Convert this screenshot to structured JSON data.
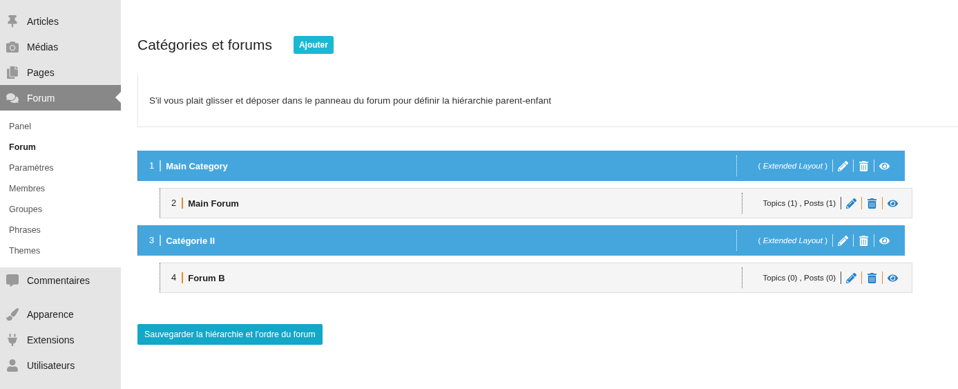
{
  "sidebar": {
    "items": [
      {
        "label": "Articles",
        "selected": false
      },
      {
        "label": "Médias",
        "selected": false
      },
      {
        "label": "Pages",
        "selected": false
      },
      {
        "label": "Forum",
        "selected": true,
        "children": [
          {
            "label": "Panel",
            "selected": false
          },
          {
            "label": "Forum",
            "selected": true
          },
          {
            "label": "Paramètres",
            "selected": false
          },
          {
            "label": "Membres",
            "selected": false
          },
          {
            "label": "Groupes",
            "selected": false
          },
          {
            "label": "Phrases",
            "selected": false
          },
          {
            "label": "Themes",
            "selected": false
          }
        ]
      },
      {
        "label": "Commentaires",
        "selected": false
      },
      {
        "label": "Apparence",
        "selected": false
      },
      {
        "label": "Extensions",
        "selected": false
      },
      {
        "label": "Utilisateurs",
        "selected": false
      }
    ]
  },
  "page": {
    "title": "Catégories et forums",
    "add_button": "Ajouter",
    "notice": "S'il vous plait glisser et déposer dans le panneau du forum pour définir la hiérarchie parent-enfant",
    "rows": [
      {
        "kind": "category",
        "number": "1",
        "name": "Main Category",
        "info": "Extended Layout",
        "open": "(",
        "close": ")"
      },
      {
        "kind": "forum",
        "number": "2",
        "name": "Main Forum",
        "info": "Topics (1) , Posts (1)"
      },
      {
        "kind": "category",
        "number": "3",
        "name": "Catégorie II",
        "info": "Extended Layout",
        "open": "(",
        "close": ")"
      },
      {
        "kind": "forum",
        "number": "4",
        "name": "Forum B",
        "info": "Topics (0) , Posts (0)"
      }
    ],
    "save_button": "Sauvegarder la hiérarchie et l'ordre du forum"
  }
}
